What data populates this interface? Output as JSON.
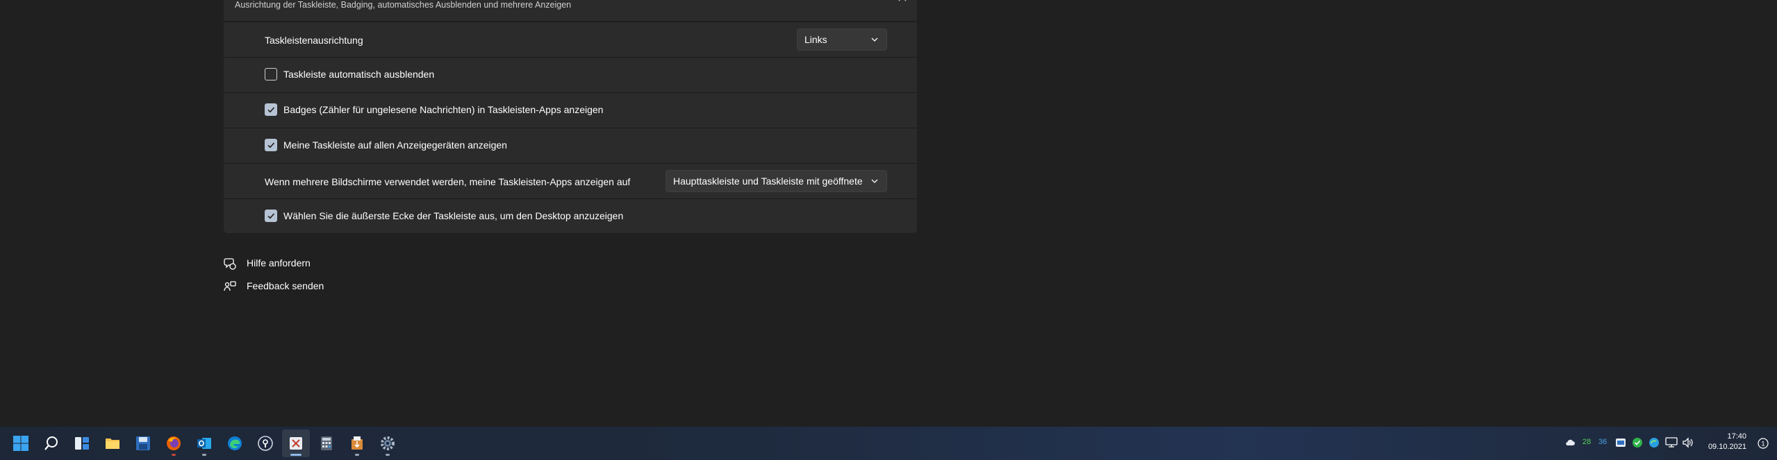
{
  "panel": {
    "subtitle": "Ausrichtung der Taskleiste, Badging, automatisches Ausblenden und mehrere Anzeigen",
    "rows": [
      {
        "label": "Taskleistenausrichtung",
        "dropdown": "Links"
      },
      {
        "label": "Taskleiste automatisch ausblenden",
        "checked": false
      },
      {
        "label": "Badges (Zähler für ungelesene Nachrichten) in Taskleisten-Apps anzeigen",
        "checked": true
      },
      {
        "label": "Meine Taskleiste auf allen Anzeigegeräten anzeigen",
        "checked": true
      },
      {
        "label": "Wenn mehrere Bildschirme verwendet werden, meine Taskleisten-Apps anzeigen auf",
        "dropdown": "Haupttaskleiste und Taskleiste mit geöffnetem Fenster"
      },
      {
        "label": "Wählen Sie die äußerste Ecke der Taskleiste aus, um den Desktop anzuzeigen",
        "checked": true
      }
    ]
  },
  "links": {
    "help": "Hilfe anfordern",
    "feedback": "Feedback senden"
  },
  "taskbar": {
    "apps": [
      "start-icon",
      "search-icon",
      "task-view-icon",
      "file-explorer-icon",
      "save-disk-icon",
      "firefox-icon",
      "outlook-icon",
      "edge-icon",
      "password-manager-icon",
      "snipping-tool-icon",
      "calculator-icon",
      "app-installer-icon",
      "settings-icon"
    ],
    "tray": {
      "temp1": "28",
      "temp2": "36"
    },
    "clock": {
      "time": "17:40",
      "date": "09.10.2021"
    },
    "notification_count": "1"
  },
  "colors": {
    "background": "#202020",
    "panel": "#2b2b2b",
    "accent_check": "#b6c3d4",
    "taskbar": "#1e2a3d"
  }
}
